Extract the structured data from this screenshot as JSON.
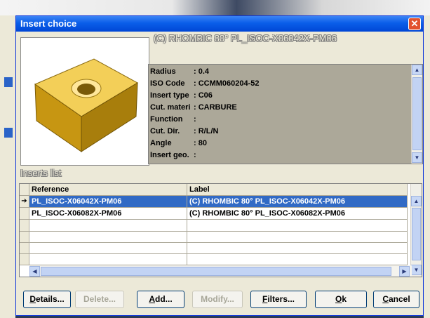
{
  "dialog": {
    "title": "Insert choice",
    "close_glyph": "✕",
    "description": "(C) RHOMBIC 80° PL_ISOC-X06042X-PM06",
    "insert_icon": "insert-3d-icon"
  },
  "properties": [
    {
      "key": "Radius",
      "value": ": 0.4"
    },
    {
      "key": "ISO Code",
      "value": ": CCMM060204-52"
    },
    {
      "key": "Insert type",
      "value": ": C06"
    },
    {
      "key": "Cut. materi",
      "value": ": CARBURE"
    },
    {
      "key": "Function",
      "value": ":"
    },
    {
      "key": "Cut. Dir.",
      "value": ": R/L/N"
    },
    {
      "key": "Angle",
      "value": ": 80"
    },
    {
      "key": "Insert geo.",
      "value": ":"
    }
  ],
  "inserts_list": {
    "label": "Inserts list",
    "columns": [
      "Reference",
      "Label"
    ],
    "row_marker": "➔",
    "rows": [
      {
        "reference": "PL_ISOC-X06042X-PM06",
        "label": "(C) RHOMBIC 80° PL_ISOC-X06042X-PM06",
        "selected": true
      },
      {
        "reference": "PL_ISOC-X06082X-PM06",
        "label": "(C) RHOMBIC 80° PL_ISOC-X06082X-PM06",
        "selected": false
      }
    ]
  },
  "buttons": [
    {
      "first": "D",
      "rest": "etails...",
      "enabled": true,
      "name": "details-button"
    },
    {
      "first": "",
      "rest": "Delete...",
      "enabled": false,
      "name": "delete-button"
    },
    {
      "first": "A",
      "rest": "dd...",
      "enabled": true,
      "name": "add-button"
    },
    {
      "first": "",
      "rest": "Modify...",
      "enabled": false,
      "name": "modify-button"
    },
    {
      "first": "F",
      "rest": "ilters...",
      "enabled": true,
      "name": "filters-button"
    },
    {
      "first": "O",
      "rest": "k",
      "enabled": true,
      "name": "ok-button"
    },
    {
      "first": "C",
      "rest": "ancel",
      "enabled": true,
      "name": "cancel-button"
    }
  ],
  "colors": {
    "titlebar": "#0a5ee9",
    "selection": "#316ac5",
    "properties_bg": "#aca899",
    "insert_gold": "#d9a520"
  }
}
